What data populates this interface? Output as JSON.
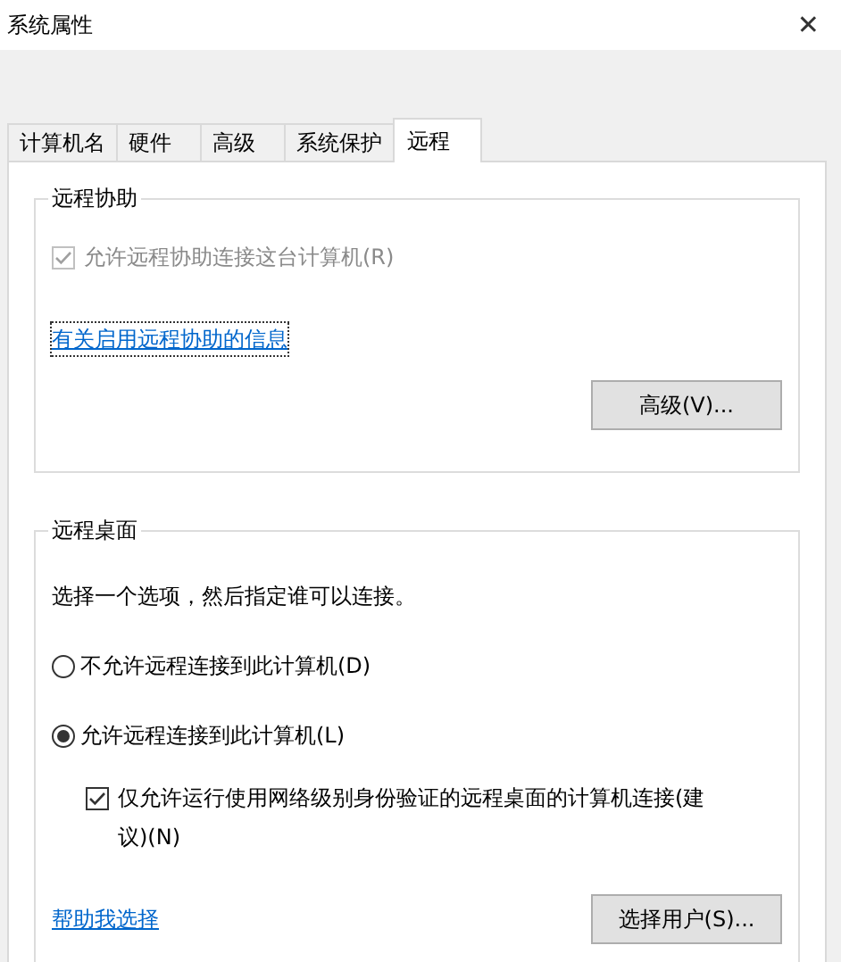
{
  "window": {
    "title": "系统属性",
    "close": "✕"
  },
  "tabs": [
    {
      "label": "计算机名",
      "selected": false
    },
    {
      "label": "硬件",
      "selected": false
    },
    {
      "label": "高级",
      "selected": false
    },
    {
      "label": "系统保护",
      "selected": false
    },
    {
      "label": "远程",
      "selected": true
    }
  ],
  "remote_assistance": {
    "title": "远程协助",
    "checkbox": {
      "label": "允许远程协助连接这台计算机(R)",
      "checked": true,
      "disabled": true
    },
    "link": "有关启用远程协助的信息",
    "button": "高级(V)..."
  },
  "remote_desktop": {
    "title": "远程桌面",
    "instruction": "选择一个选项，然后指定谁可以连接。",
    "options": [
      {
        "label": "不允许远程连接到此计算机(D)",
        "selected": false
      },
      {
        "label": "允许远程连接到此计算机(L)",
        "selected": true
      }
    ],
    "nla_checkbox": {
      "label": "仅允许运行使用网络级别身份验证的远程桌面的计算机连接(建议)(N)",
      "checked": true,
      "disabled": false
    },
    "link": "帮助我选择",
    "button": "选择用户(S)..."
  }
}
